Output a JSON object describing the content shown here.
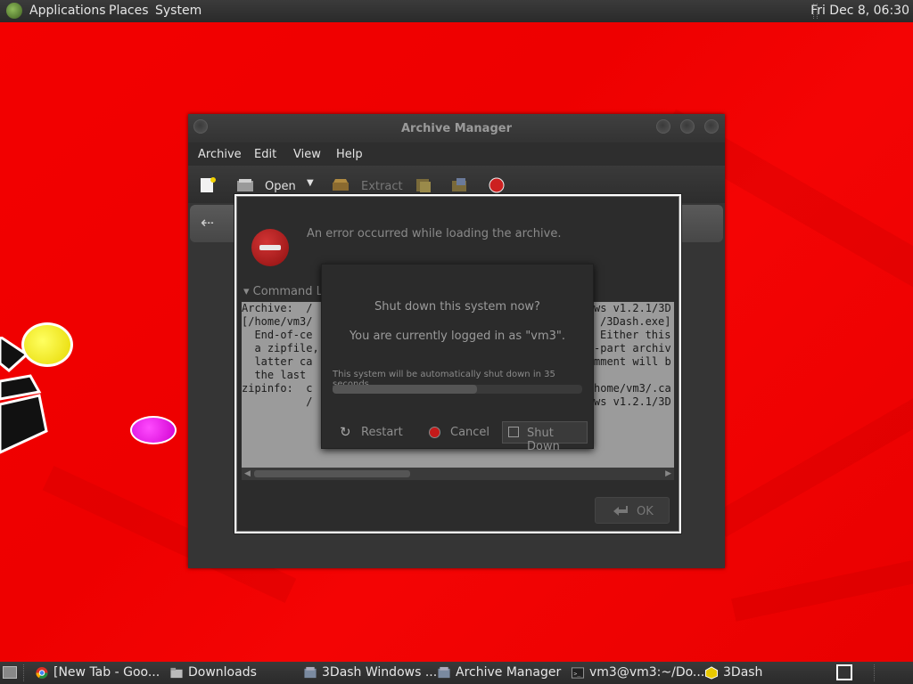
{
  "top_panel": {
    "menus": [
      "Applications",
      "Places",
      "System"
    ],
    "clock": "Fri Dec  8, 06:30"
  },
  "archive_window": {
    "title": "Archive Manager",
    "menubar": [
      "Archive",
      "Edit",
      "View",
      "Help"
    ],
    "toolbar": {
      "open_label": "Open",
      "extract_label": "Extract"
    }
  },
  "error_dialog": {
    "message": "An error occurred while loading the archive.",
    "command_line_label": "Command Li",
    "output_lines": [
      "Archive:  /",
      "[/home/vm3/",
      "  End-of-ce",
      "  a zipfile,",
      "  latter ca",
      "  the last ",
      "zipinfo:  c",
      "          /"
    ],
    "output_right_lines": [
      "ws v1.2.1/3D",
      "/3Dash.exe]",
      "Either this",
      "-part archiv",
      "mment will b",
      "",
      "home/vm3/.ca",
      "ws v1.2.1/3D"
    ],
    "ok_label": "OK"
  },
  "shutdown_dialog": {
    "question": "Shut down this system now?",
    "logged_in": "You are currently logged in as \"vm3\".",
    "timer_text": "This system will be automatically shut down in 35 seconds.",
    "progress_fraction": 0.58,
    "buttons": {
      "restart": "Restart",
      "cancel": "Cancel",
      "shutdown": "Shut Down"
    }
  },
  "taskbar": {
    "tasks": [
      {
        "label": "[New Tab - Goo...",
        "icon": "chrome-icon"
      },
      {
        "label": "Downloads",
        "icon": "folder-icon"
      },
      {
        "label": "3Dash Windows ...",
        "icon": "archive-icon"
      },
      {
        "label": "Archive Manager",
        "icon": "archive-icon"
      },
      {
        "label": "vm3@vm3:~/Do...",
        "icon": "terminal-icon"
      },
      {
        "label": "3Dash",
        "icon": "cube-icon"
      }
    ]
  }
}
